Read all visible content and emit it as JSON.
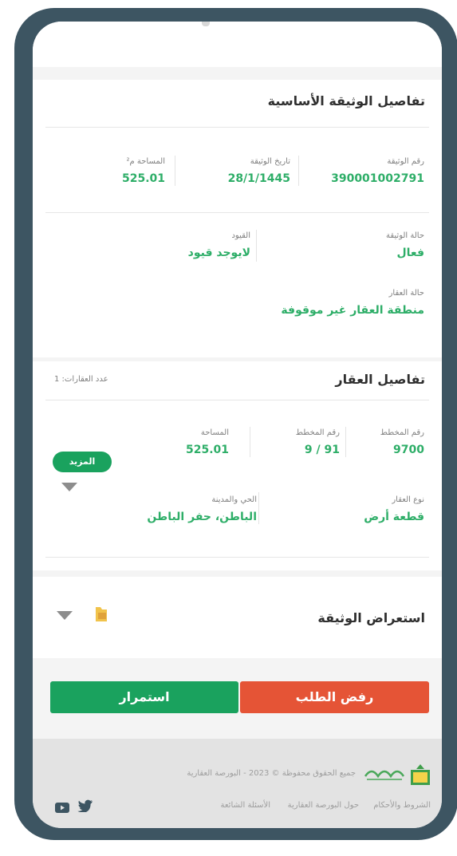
{
  "document_details": {
    "title": "تفاصيل الوثيقة الأساسية",
    "deed_number": {
      "label": "رقم الوثيقة",
      "value": "390001002791"
    },
    "deed_date": {
      "label": "تاريخ الوثيقة",
      "value": "28/1/1445"
    },
    "area": {
      "label": "المساحة م²",
      "value": "525.01"
    },
    "deed_status": {
      "label": "حالة الوثيقة",
      "value": "فعال"
    },
    "restrictions": {
      "label": "القيود",
      "value": "لايوجد قيود"
    },
    "property_status": {
      "label": "حالة العقار",
      "value": "منطقة العقار غير موقوفة"
    }
  },
  "property_details": {
    "title": "تفاصيل العقار",
    "count": "عدد العقارات: 1",
    "plan_number": {
      "label": "رقم المخطط",
      "value": "9700"
    },
    "plot_number": {
      "label": "رقم المخطط",
      "value": "91 / 9"
    },
    "area": {
      "label": "المساحة",
      "value": "525.01"
    },
    "more_button": "المزيد",
    "property_type": {
      "label": "نوع العقار",
      "value": "قطعة أرض"
    },
    "district_city": {
      "label": "الحي والمدينة",
      "value": "الباطن، حفر الباطن"
    }
  },
  "document_view": {
    "title": "استعراض الوثيقة",
    "icon": "folder-icon"
  },
  "actions": {
    "reject": "رفض الطلب",
    "continue": "استمرار"
  },
  "footer": {
    "copyright": "جميع الحقوق محفوظة © 2023 - البورصة العقارية",
    "links": [
      "الشروط والأحكام",
      "حول البورصة العقارية",
      "الأسئلة الشائعة"
    ],
    "social": [
      "twitter-icon",
      "youtube-icon"
    ]
  },
  "colors": {
    "accent_green": "#1aa25e",
    "value_green": "#2eae68",
    "reject_red": "#e55436",
    "frame": "#3d5562"
  }
}
